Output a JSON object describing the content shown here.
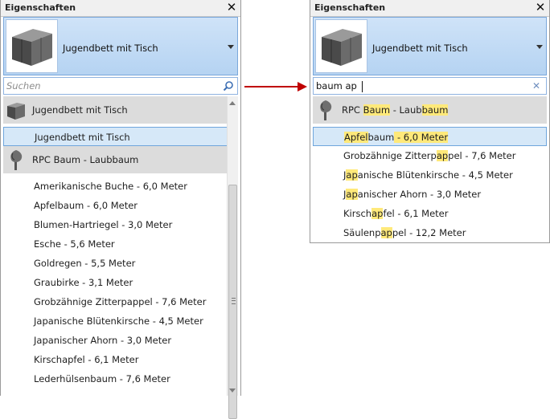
{
  "left_panel": {
    "title": "Eigenschaften",
    "close_glyph": "✕",
    "type_selector": {
      "name": "Jugendbett mit Tisch"
    },
    "search": {
      "placeholder": "Suchen",
      "value": ""
    },
    "list": [
      {
        "kind": "group",
        "label": "Jugendbett mit Tisch",
        "icon": "bed-furniture-icon"
      },
      {
        "kind": "item",
        "label": "Jugendbett mit Tisch",
        "selected": true
      },
      {
        "kind": "group",
        "label": "RPC Baum - Laubbaum",
        "icon": "tree-icon"
      },
      {
        "kind": "item",
        "label": "Amerikanische Buche - 6,0 Meter"
      },
      {
        "kind": "item",
        "label": "Apfelbaum - 6,0 Meter"
      },
      {
        "kind": "item",
        "label": "Blumen-Hartriegel - 3,0 Meter"
      },
      {
        "kind": "item",
        "label": "Esche - 5,6 Meter"
      },
      {
        "kind": "item",
        "label": "Goldregen - 5,5 Meter"
      },
      {
        "kind": "item",
        "label": "Graubirke - 3,1 Meter"
      },
      {
        "kind": "item",
        "label": "Grobzähnige Zitterpappel - 7,6 Meter"
      },
      {
        "kind": "item",
        "label": "Japanische Blütenkirsche - 4,5 Meter"
      },
      {
        "kind": "item",
        "label": "Japanischer Ahorn - 3,0 Meter"
      },
      {
        "kind": "item",
        "label": "Kirschapfel - 6,1 Meter"
      },
      {
        "kind": "item",
        "label": "Lederhülsenbaum - 7,6 Meter"
      }
    ]
  },
  "right_panel": {
    "title": "Eigenschaften",
    "close_glyph": "✕",
    "type_selector": {
      "name": "Jugendbett mit Tisch"
    },
    "search": {
      "value": "baum ap",
      "clear_glyph": "✕"
    },
    "list": [
      {
        "kind": "group",
        "icon": "tree-icon",
        "parts": [
          "RPC ",
          "Baum",
          " - Laub",
          "baum"
        ]
      },
      {
        "kind": "item",
        "selected": true,
        "parts": [
          "",
          "Apfel",
          "baum",
          " - 6,0 Meter"
        ]
      },
      {
        "kind": "item",
        "parts": [
          "Grobzähnige Zitterp",
          "ap",
          "pel - 7,6 Meter"
        ]
      },
      {
        "kind": "item",
        "parts": [
          "J",
          "ap",
          "anische Blütenkirsche - 4,5 Meter"
        ]
      },
      {
        "kind": "item",
        "parts": [
          "J",
          "ap",
          "anischer Ahorn - 3,0 Meter"
        ]
      },
      {
        "kind": "item",
        "parts": [
          "Kirsch",
          "ap",
          "fel - 6,1 Meter"
        ]
      },
      {
        "kind": "item",
        "parts": [
          "Säulenp",
          "ap",
          "pel - 12,2 Meter"
        ]
      }
    ]
  },
  "colors": {
    "accent": "#b5d3f2",
    "selection": "#d6e8f8",
    "group_background": "#dcdcdc",
    "highlight": "#ffe97a",
    "arrow": "#c00000"
  }
}
